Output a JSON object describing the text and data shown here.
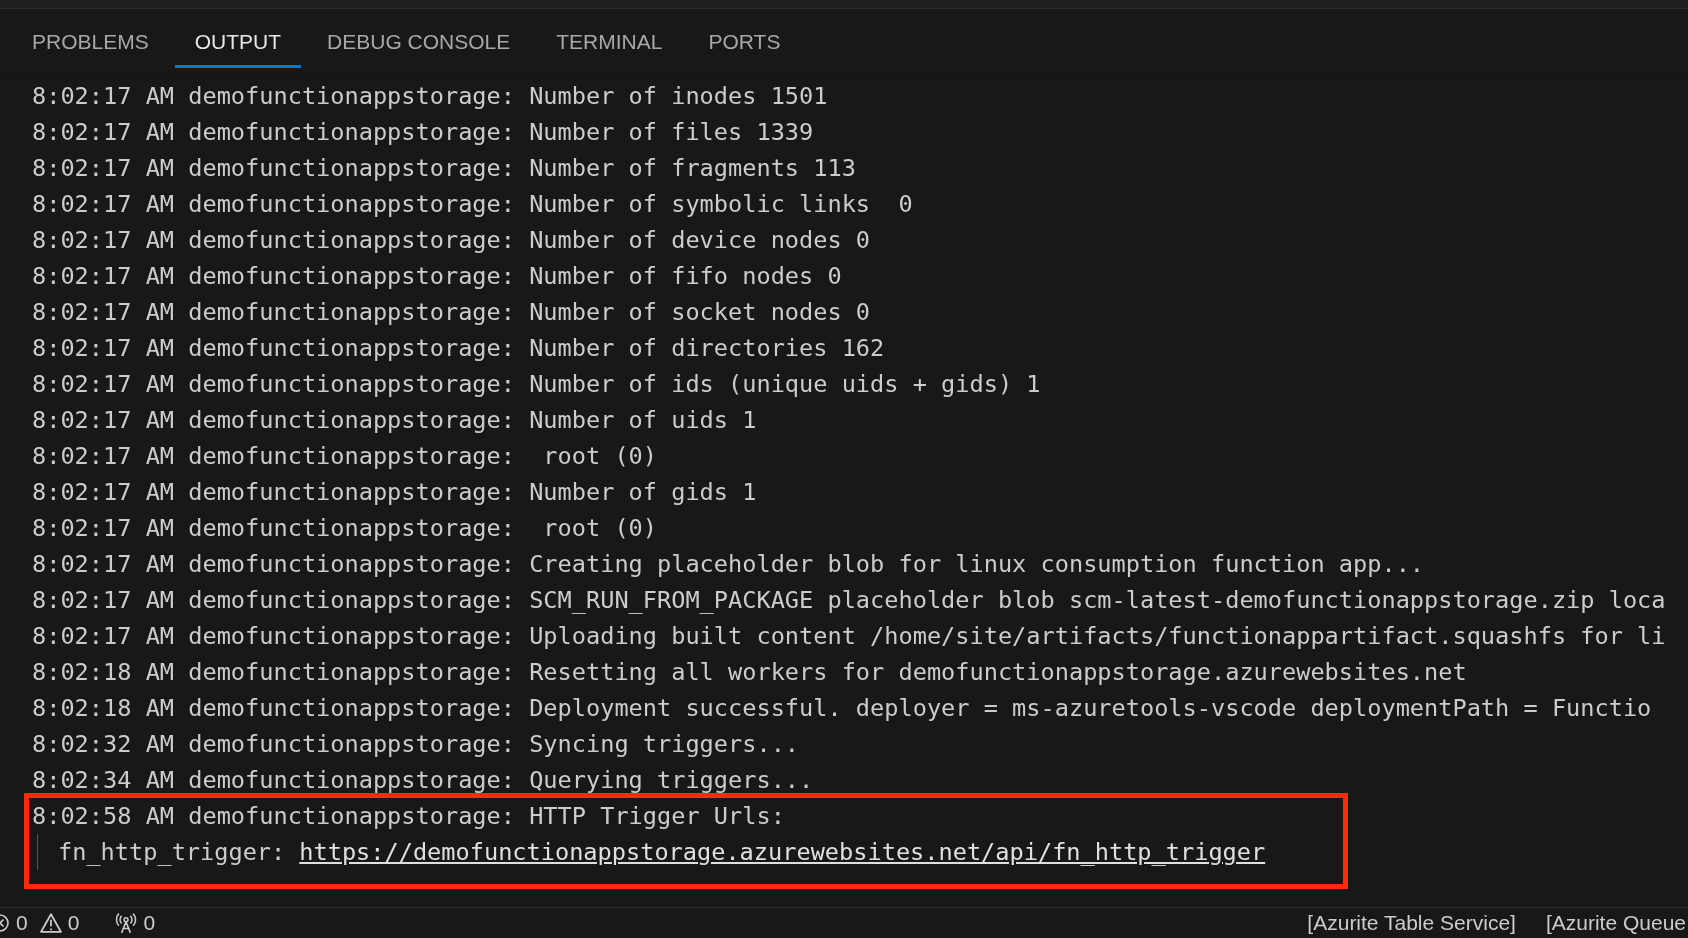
{
  "tabs": [
    {
      "label": "PROBLEMS",
      "selected": false
    },
    {
      "label": "OUTPUT",
      "selected": true
    },
    {
      "label": "DEBUG CONSOLE",
      "selected": false
    },
    {
      "label": "TERMINAL",
      "selected": false
    },
    {
      "label": "PORTS",
      "selected": false
    }
  ],
  "output_lines": [
    {
      "text": "8:02:17 AM demofunctionappstorage: Number of inodes 1501",
      "highlighted": false
    },
    {
      "text": "8:02:17 AM demofunctionappstorage: Number of files 1339",
      "highlighted": false
    },
    {
      "text": "8:02:17 AM demofunctionappstorage: Number of fragments 113",
      "highlighted": false
    },
    {
      "text": "8:02:17 AM demofunctionappstorage: Number of symbolic links  0",
      "highlighted": false
    },
    {
      "text": "8:02:17 AM demofunctionappstorage: Number of device nodes 0",
      "highlighted": false
    },
    {
      "text": "8:02:17 AM demofunctionappstorage: Number of fifo nodes 0",
      "highlighted": false
    },
    {
      "text": "8:02:17 AM demofunctionappstorage: Number of socket nodes 0",
      "highlighted": false
    },
    {
      "text": "8:02:17 AM demofunctionappstorage: Number of directories 162",
      "highlighted": false
    },
    {
      "text": "8:02:17 AM demofunctionappstorage: Number of ids (unique uids + gids) 1",
      "highlighted": false
    },
    {
      "text": "8:02:17 AM demofunctionappstorage: Number of uids 1",
      "highlighted": false
    },
    {
      "text": "8:02:17 AM demofunctionappstorage:  root (0)",
      "highlighted": false
    },
    {
      "text": "8:02:17 AM demofunctionappstorage: Number of gids 1",
      "highlighted": false
    },
    {
      "text": "8:02:17 AM demofunctionappstorage:  root (0)",
      "highlighted": false
    },
    {
      "text": "8:02:17 AM demofunctionappstorage: Creating placeholder blob for linux consumption function app...",
      "highlighted": false
    },
    {
      "text": "8:02:17 AM demofunctionappstorage: SCM_RUN_FROM_PACKAGE placeholder blob scm-latest-demofunctionappstorage.zip loca",
      "highlighted": false
    },
    {
      "text": "8:02:17 AM demofunctionappstorage: Uploading built content /home/site/artifacts/functionappartifact.squashfs for li",
      "highlighted": false
    },
    {
      "text": "8:02:18 AM demofunctionappstorage: Resetting all workers for demofunctionappstorage.azurewebsites.net",
      "highlighted": false
    },
    {
      "text": "8:02:18 AM demofunctionappstorage: Deployment successful. deployer = ms-azuretools-vscode deploymentPath = Functio",
      "highlighted": false
    },
    {
      "text": "8:02:32 AM demofunctionappstorage: Syncing triggers...",
      "highlighted": false
    },
    {
      "text": "8:02:34 AM demofunctionappstorage: Querying triggers...",
      "highlighted": false
    }
  ],
  "callout": {
    "highlighted": true,
    "line": "8:02:58 AM demofunctionappstorage: HTTP Trigger Urls:",
    "trigger": {
      "name": "fn_http_trigger:",
      "url": "https://demofunctionappstorage.azurewebsites.net/api/fn_http_trigger"
    }
  },
  "status_bar": {
    "errors": "0",
    "warnings": "0",
    "ports": "0",
    "items": [
      "[Azurite Table Service]",
      "[Azurite Queue"
    ]
  }
}
